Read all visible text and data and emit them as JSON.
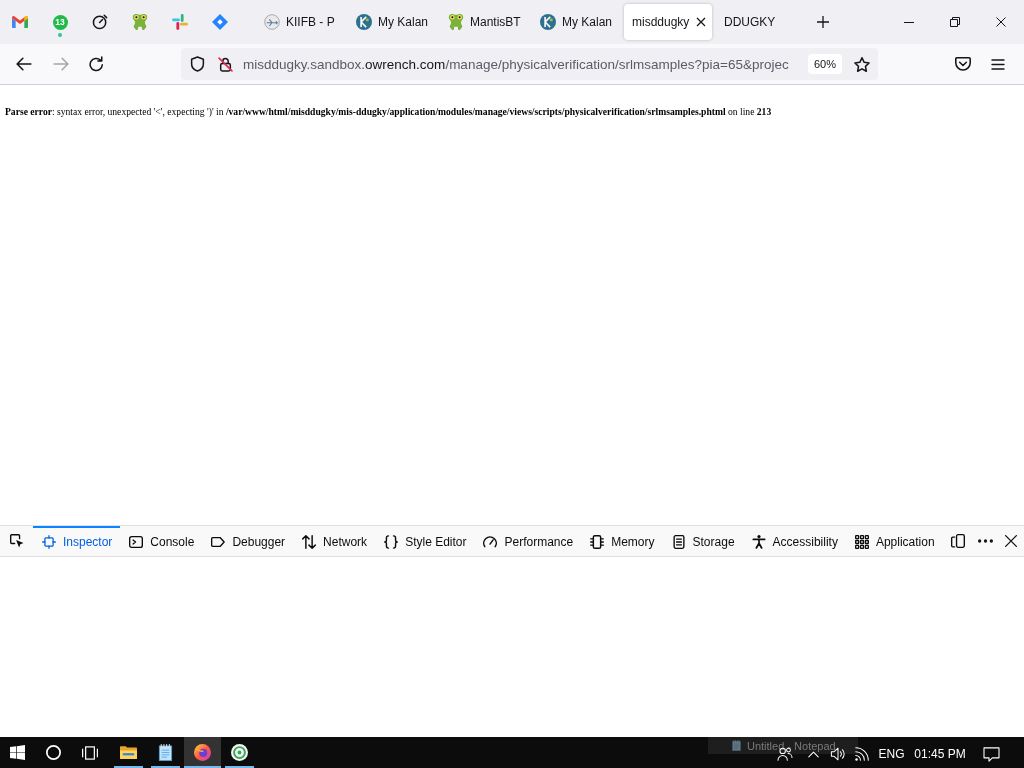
{
  "tab_bar": {
    "pinned_tabs": [
      {
        "selected": false
      },
      {
        "selected": false,
        "badge": "13",
        "notification": true
      },
      {
        "selected": false
      },
      {
        "selected": false
      },
      {
        "selected": false
      },
      {
        "selected": false
      }
    ],
    "tabs": [
      {
        "title": "KIIFB - P",
        "selected": false
      },
      {
        "title": "My Kalan",
        "selected": false
      },
      {
        "title": "MantisBT",
        "selected": false
      },
      {
        "title": "My Kalan",
        "selected": false
      },
      {
        "title": "misddugky",
        "selected": true
      },
      {
        "title": "DDUGKY",
        "selected": false
      }
    ]
  },
  "nav_bar": {
    "back": {
      "disabled": false
    },
    "forward": {
      "disabled": true
    },
    "url": {
      "host_prefix": "misddugky.sandbox.",
      "host_domain": "owrench.com",
      "path": "/manage/physicalverification/srlmsamples?pia=65&projec"
    },
    "zoom": "60%"
  },
  "page": {
    "error": "**Parse error**: syntax error, unexpected '<', expecting ')' in **/var/www/html/misddugky/mis-ddugky/application/modules/manage/views/scripts/physicalverification/srlmsamples.phtml** on line **213**"
  },
  "devtools": {
    "tabs": [
      {
        "label": "Inspector",
        "selected": true
      },
      {
        "label": "Console",
        "selected": false
      },
      {
        "label": "Debugger",
        "selected": false
      },
      {
        "label": "Network",
        "selected": false
      },
      {
        "label": "Style Editor",
        "selected": false
      },
      {
        "label": "Performance",
        "selected": false
      },
      {
        "label": "Memory",
        "selected": false
      },
      {
        "label": "Storage",
        "selected": false
      },
      {
        "label": "Accessibility",
        "selected": false
      },
      {
        "label": "Application",
        "selected": false
      }
    ]
  },
  "taskbar": {
    "apps": [
      {
        "running": true,
        "active": false
      },
      {
        "running": true,
        "active": false
      },
      {
        "running": true,
        "active": true
      },
      {
        "running": true,
        "active": false
      }
    ],
    "window_preview": "Untitled - Notepad",
    "language": "ENG",
    "time": "01:45 PM"
  }
}
